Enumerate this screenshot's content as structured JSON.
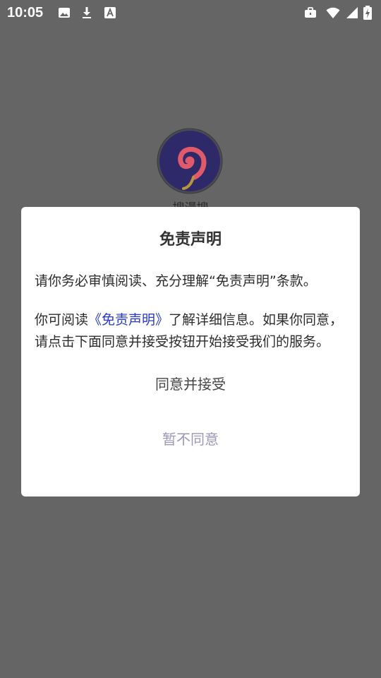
{
  "status_bar": {
    "time": "10:05",
    "left_icons": [
      "image-icon",
      "download-icon",
      "font-icon"
    ],
    "right_icons": [
      "briefcase-icon",
      "wifi-icon",
      "signal-icon",
      "battery-charging-icon"
    ]
  },
  "app": {
    "name": "搜漫搜"
  },
  "dialog": {
    "title": "免责声明",
    "paragraph1": "请你务必审慎阅读、充分理解“免责声明”条款。",
    "paragraph2_prefix": "你可阅读",
    "paragraph2_link": "《免责声明》",
    "paragraph2_suffix": "了解详细信息。如果你同意，请点击下面同意并接受按钮开始接受我们的服务。",
    "accept_label": "同意并接受",
    "decline_label": "暂不同意"
  },
  "colors": {
    "overlay": "#656565",
    "link": "#2838c8",
    "decline": "#9c97b8",
    "logo_bg": "#2e2a6a",
    "logo_swirl": "#e05a6a"
  }
}
